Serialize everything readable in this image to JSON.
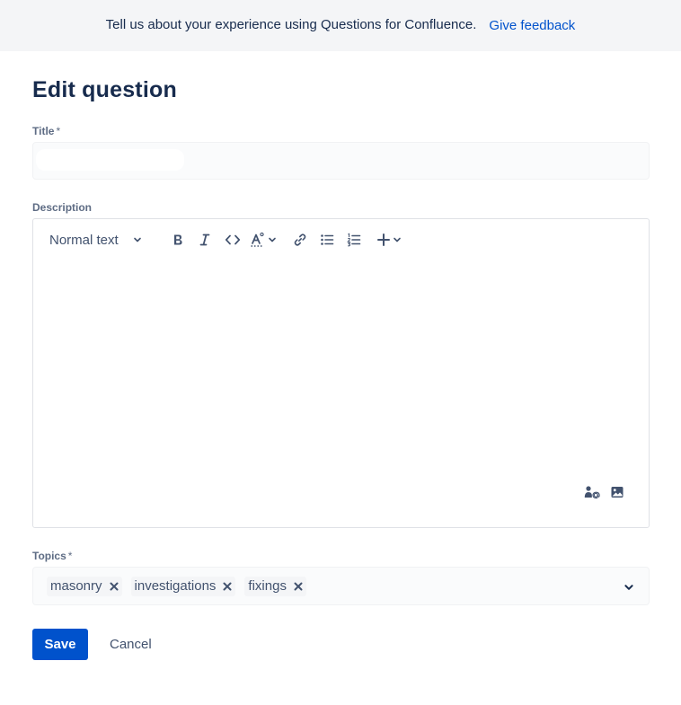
{
  "banner": {
    "message": "Tell us about your experience using Questions for Confluence.",
    "link_label": "Give feedback"
  },
  "page": {
    "title": "Edit question"
  },
  "title_field": {
    "label": "Title",
    "required_mark": "*",
    "value": ""
  },
  "description_field": {
    "label": "Description",
    "toolbar": {
      "text_style": "Normal text",
      "icons": [
        "bold-icon",
        "italic-icon",
        "code-icon",
        "text-color-icon",
        "link-icon",
        "bullet-list-icon",
        "numbered-list-icon",
        "insert-plus-icon"
      ]
    },
    "bottom_icons": [
      "mention-icon",
      "image-icon"
    ]
  },
  "topics_field": {
    "label": "Topics",
    "required_mark": "*",
    "tags": [
      {
        "label": "masonry"
      },
      {
        "label": "investigations"
      },
      {
        "label": "fixings"
      }
    ]
  },
  "actions": {
    "save_label": "Save",
    "cancel_label": "Cancel"
  },
  "colors": {
    "primary": "#0052cc",
    "text": "#172b4d",
    "subtle_text": "#42526e",
    "label": "#5e6c84",
    "banner_bg": "#f4f5f7"
  }
}
